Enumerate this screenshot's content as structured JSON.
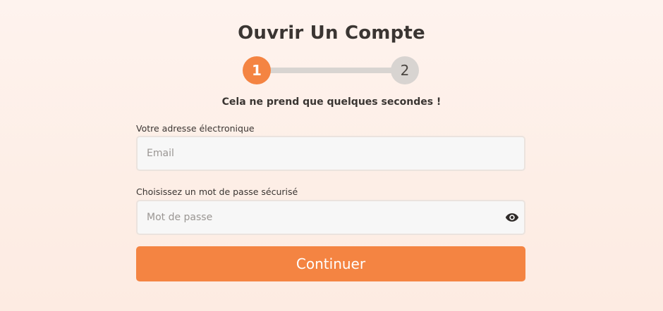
{
  "header": {
    "title": "Ouvrir Un Compte",
    "subtitle": "Cela ne prend que quelques secondes !"
  },
  "stepper": {
    "steps": [
      {
        "label": "1",
        "state": "active"
      },
      {
        "label": "2",
        "state": "inactive"
      }
    ]
  },
  "form": {
    "email": {
      "label": "Votre adresse électronique",
      "placeholder": "Email",
      "value": ""
    },
    "password": {
      "label": "Choisissez un mot de passe sécurisé",
      "placeholder": "Mot de passe",
      "value": "",
      "toggle_icon": "eye-icon"
    },
    "submit_label": "Continuer"
  },
  "colors": {
    "accent": "#f48442",
    "inactive_step": "#d8d4d1",
    "text": "#3a3532",
    "background": "#fef3ee"
  }
}
